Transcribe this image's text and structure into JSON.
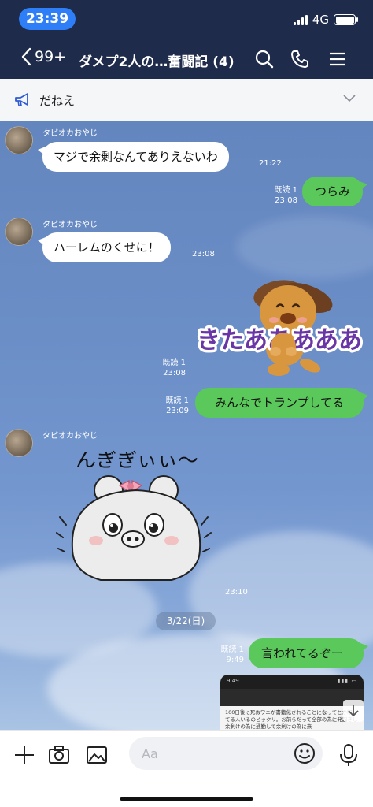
{
  "status_bar": {
    "time": "23:39",
    "network": "4G"
  },
  "header": {
    "back_count": "99+",
    "title": "ダメプ2人の…奮闘記 (4)"
  },
  "announcement": {
    "text": "だねえ"
  },
  "messages": [
    {
      "sender": "タピオカおやじ",
      "text": "マジで余剰なんてありえないわ",
      "time": "21:22"
    },
    {
      "text": "つらみ",
      "read": "既読 1",
      "time": "23:08"
    },
    {
      "sender": "タピオカおやじ",
      "text": "ハーレムのくせに！",
      "time": "23:08"
    },
    {
      "sticker": "dog-sticker",
      "sticker_text": "きたあああああ",
      "read": "既読 1",
      "time": "23:08"
    },
    {
      "text": "みんなでトランプしてる",
      "read": "既読 1",
      "time": "23:09"
    },
    {
      "sender": "タピオカおやじ",
      "sticker": "bear-sticker",
      "sticker_text": "んぎぎぃぃ〜",
      "time": "23:10"
    },
    {
      "text": "言われてるぞー",
      "read": "既読 1",
      "time": "9:49"
    },
    {
      "screenshot_text": "100日後に死ぬワニが書籍化されることになってとか叩いてる人いるのビックリ。お前らだって全部の為に発起きし余剰けの為に通勤して余剰けの為に来",
      "screenshot_time": "9:49"
    }
  ],
  "date_separator": "3/22(日)",
  "input": {
    "placeholder": "Aa"
  },
  "colors": {
    "header_bg": "#1f2b4a",
    "outgoing_bubble": "#5ac85a",
    "time_pill": "#2d7ef7"
  }
}
